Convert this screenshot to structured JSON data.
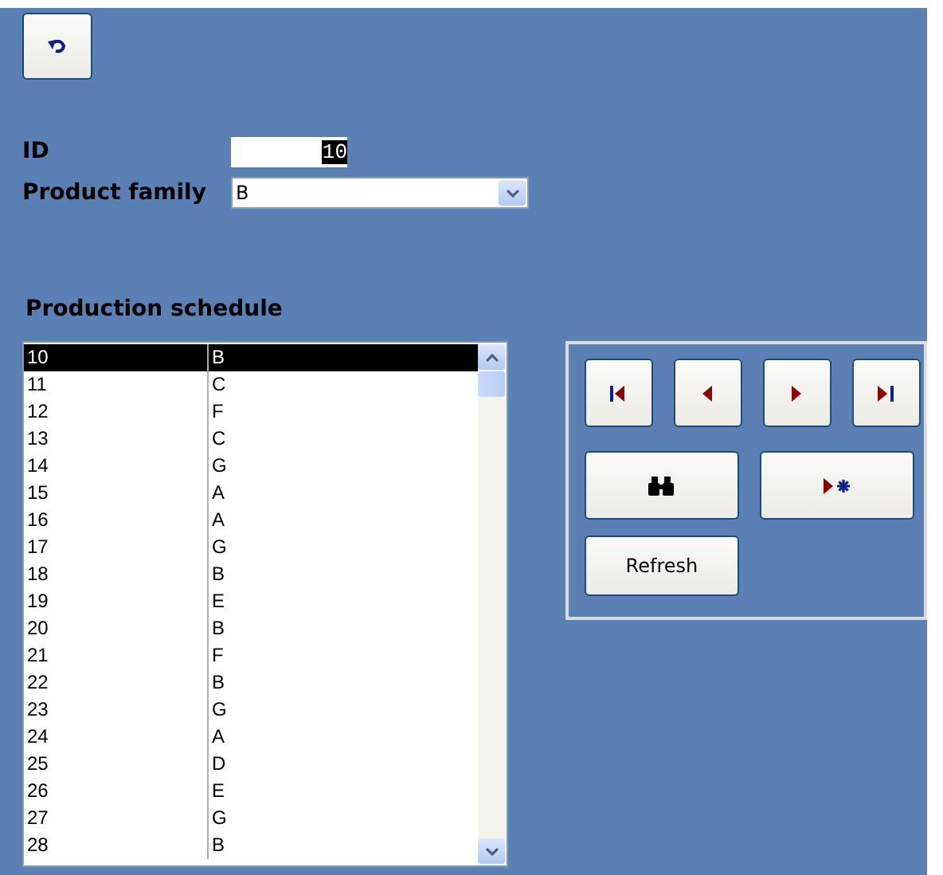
{
  "form": {
    "id_label": "ID",
    "id_value": "10",
    "id_text_selected": true,
    "family_label": "Product family",
    "family_value": "B"
  },
  "schedule": {
    "title": "Production schedule",
    "rows": [
      {
        "id": "10",
        "family": "B",
        "selected": true
      },
      {
        "id": "11",
        "family": "C",
        "selected": false
      },
      {
        "id": "12",
        "family": "F",
        "selected": false
      },
      {
        "id": "13",
        "family": "C",
        "selected": false
      },
      {
        "id": "14",
        "family": "G",
        "selected": false
      },
      {
        "id": "15",
        "family": "A",
        "selected": false
      },
      {
        "id": "16",
        "family": "A",
        "selected": false
      },
      {
        "id": "17",
        "family": "G",
        "selected": false
      },
      {
        "id": "18",
        "family": "B",
        "selected": false
      },
      {
        "id": "19",
        "family": "E",
        "selected": false
      },
      {
        "id": "20",
        "family": "B",
        "selected": false
      },
      {
        "id": "21",
        "family": "F",
        "selected": false
      },
      {
        "id": "22",
        "family": "B",
        "selected": false
      },
      {
        "id": "23",
        "family": "G",
        "selected": false
      },
      {
        "id": "24",
        "family": "A",
        "selected": false
      },
      {
        "id": "25",
        "family": "D",
        "selected": false
      },
      {
        "id": "26",
        "family": "E",
        "selected": false
      },
      {
        "id": "27",
        "family": "G",
        "selected": false
      },
      {
        "id": "28",
        "family": "B",
        "selected": false
      }
    ]
  },
  "navigator": {
    "nav_buttons": [
      {
        "kind": "first"
      },
      {
        "kind": "previous"
      },
      {
        "kind": "next"
      },
      {
        "kind": "last"
      }
    ],
    "action_buttons": [
      {
        "kind": "find"
      },
      {
        "kind": "new"
      }
    ],
    "refresh_label": "Refresh"
  }
}
